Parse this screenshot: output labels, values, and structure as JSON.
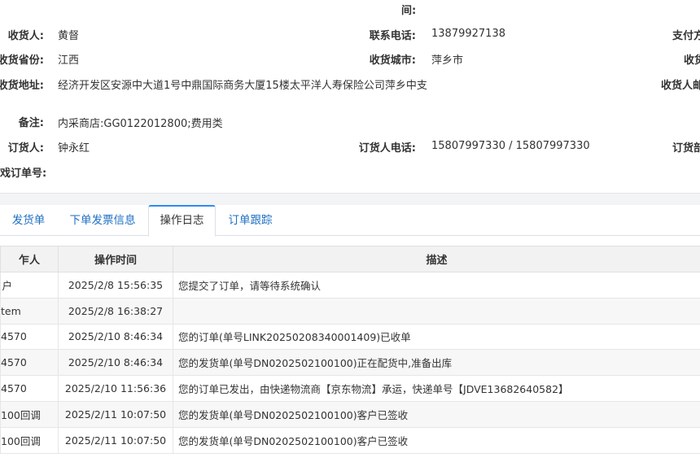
{
  "info": {
    "top_partial_label": "间:",
    "consignee_label": "收货人:",
    "consignee_value": "黄督",
    "phone_label": "联系电话:",
    "phone_value": "13879927138",
    "payment_partial_label": "支付方",
    "province_label": "收货省份:",
    "province_value": "江西",
    "city_label": "收货城市:",
    "city_value": "萍乡市",
    "right_partial_2": "收货",
    "address_label": "收货地址:",
    "address_value": "经济开发区安源中大道1号中鼎国际商务大厦15楼太平洋人寿保险公司萍乡中支",
    "right_partial_3": "收货人邮",
    "remark_label": "备注:",
    "remark_value": "内采商店:GG0122012800;费用类",
    "orderer_label": "订货人:",
    "orderer_value": "钟永红",
    "orderer_phone_label": "订货人电话:",
    "orderer_phone_value": "15807997330 / 15807997330",
    "right_partial_5": "订货部",
    "order_no_partial_label": "戏订单号:"
  },
  "tabs": [
    {
      "label": "发货单"
    },
    {
      "label": "下单发票信息"
    },
    {
      "label": "操作日志"
    },
    {
      "label": "订单跟踪"
    }
  ],
  "log_table": {
    "headers": [
      "乍人",
      "操作时间",
      "描述"
    ],
    "rows": [
      {
        "operator": "户",
        "time": "2025/2/8 15:56:35",
        "desc": "您提交了订单，请等待系统确认"
      },
      {
        "operator": "tem",
        "time": "2025/2/8 16:38:27",
        "desc": ""
      },
      {
        "operator": "4570",
        "time": "2025/2/10 8:46:34",
        "desc": "您的订单(单号LINK20250208340001409)已收单"
      },
      {
        "operator": "4570",
        "time": "2025/2/10 8:46:34",
        "desc": "您的发货单(单号DN0202502100100)正在配货中,准备出库"
      },
      {
        "operator": "4570",
        "time": "2025/2/10 11:56:36",
        "desc": "您的订单已发出，由快递物流商【京东物流】承运，快递单号【JDVE13682640582】"
      },
      {
        "operator": "100回调",
        "time": "2025/2/11 10:07:50",
        "desc": "您的发货单(单号DN0202502100100)客户已签收"
      },
      {
        "operator": "100回调",
        "time": "2025/2/11 10:07:50",
        "desc": "您的发货单(单号DN0202502100100)客户已签收"
      }
    ]
  }
}
